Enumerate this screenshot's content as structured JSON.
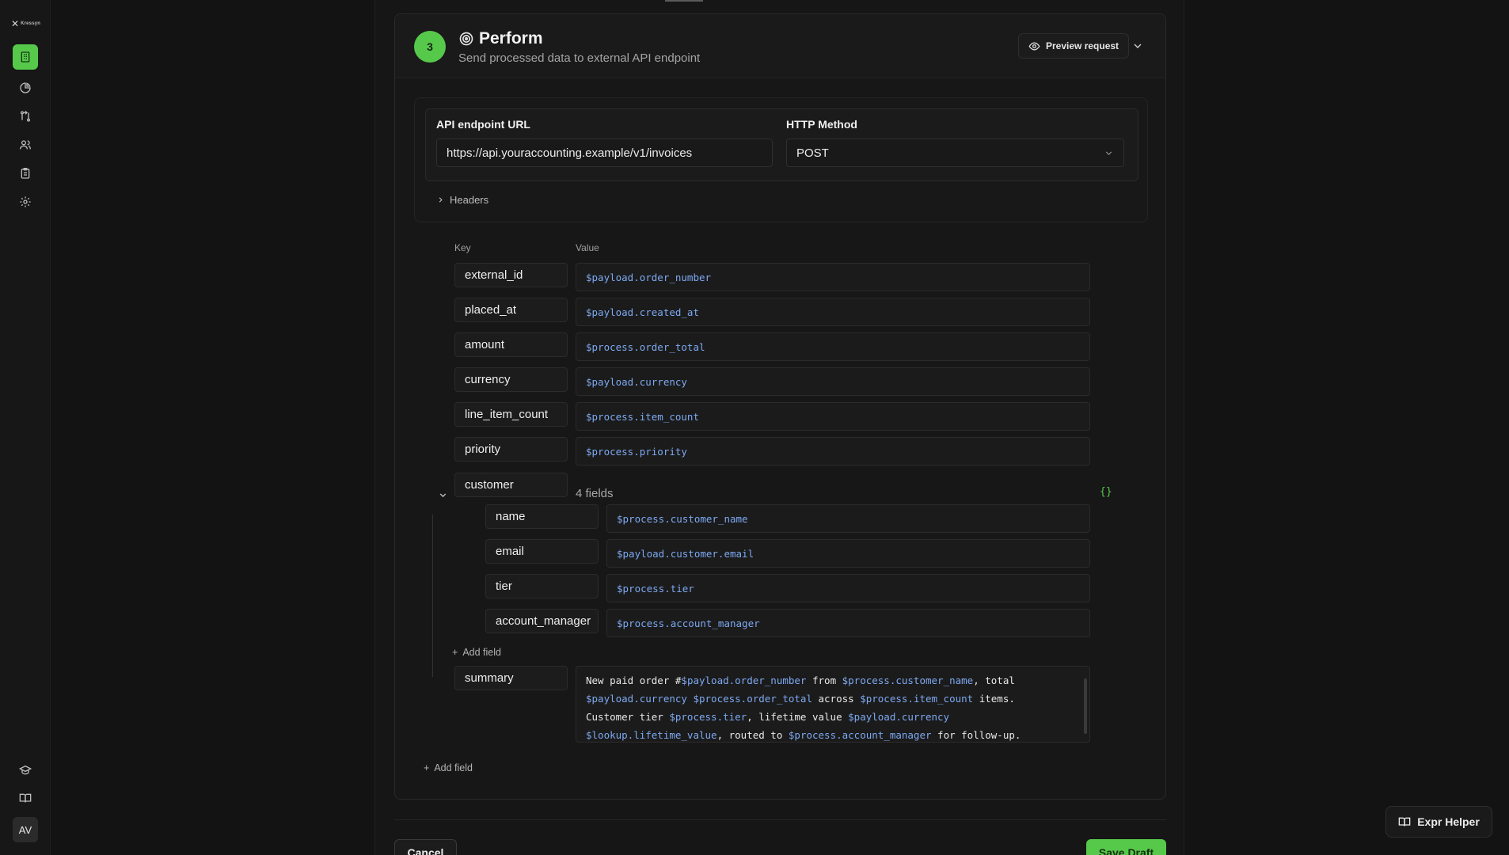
{
  "app": {
    "logo_text": "Kressyn",
    "avatar_initials": "AV"
  },
  "sidebar": {
    "items": [
      {
        "icon": "building-icon",
        "active": true
      },
      {
        "icon": "pie-chart-icon",
        "active": false
      },
      {
        "icon": "workflow-icon",
        "active": false
      },
      {
        "icon": "users-icon",
        "active": false
      },
      {
        "icon": "clipboard-icon",
        "active": false
      },
      {
        "icon": "gear-icon",
        "active": false
      }
    ],
    "bottom_items": [
      {
        "icon": "graduation-cap-icon"
      },
      {
        "icon": "book-icon"
      }
    ]
  },
  "step": {
    "number": "3",
    "title": "Perform",
    "subtitle": "Send processed data to external API endpoint",
    "preview_label": "Preview request"
  },
  "endpoint": {
    "url_label": "API endpoint URL",
    "url_value": "https://api.youraccounting.example/v1/invoices",
    "method_label": "HTTP Method",
    "method_value": "POST",
    "headers_label": "Headers"
  },
  "mapping": {
    "key_header": "Key",
    "value_header": "Value",
    "rows": [
      {
        "key": "external_id",
        "value": "$payload.order_number"
      },
      {
        "key": "placed_at",
        "value": "$payload.created_at"
      },
      {
        "key": "amount",
        "value": "$process.order_total"
      },
      {
        "key": "currency",
        "value": "$payload.currency"
      },
      {
        "key": "line_item_count",
        "value": "$process.item_count"
      },
      {
        "key": "priority",
        "value": "$process.priority"
      }
    ],
    "nested": {
      "key": "customer",
      "count_label": "4 fields",
      "json_icon_text": "{}",
      "rows": [
        {
          "key": "name",
          "value": "$process.customer_name"
        },
        {
          "key": "email",
          "value": "$payload.customer.email"
        },
        {
          "key": "tier",
          "value": "$process.tier"
        },
        {
          "key": "account_manager",
          "value": "$process.account_manager"
        }
      ],
      "add_label": "Add field"
    },
    "summary": {
      "key": "summary",
      "lines": [
        [
          {
            "t": "New paid order #"
          },
          {
            "t": "$payload.order_number",
            "v": true
          },
          {
            "t": " from "
          },
          {
            "t": "$process.customer_name",
            "v": true
          },
          {
            "t": ", total"
          }
        ],
        [
          {
            "t": "$payload.currency",
            "v": true
          },
          {
            "t": " "
          },
          {
            "t": "$process.order_total",
            "v": true
          },
          {
            "t": " across "
          },
          {
            "t": "$process.item_count",
            "v": true
          },
          {
            "t": " items."
          }
        ],
        [
          {
            "t": "Customer tier "
          },
          {
            "t": "$process.tier",
            "v": true
          },
          {
            "t": ", lifetime value "
          },
          {
            "t": "$payload.currency",
            "v": true
          }
        ],
        [
          {
            "t": "$lookup.lifetime_value",
            "v": true
          },
          {
            "t": ", routed to "
          },
          {
            "t": "$process.account_manager",
            "v": true
          },
          {
            "t": " for follow-up."
          }
        ]
      ]
    },
    "add_label": "Add field"
  },
  "footer": {
    "cancel_label": "Cancel",
    "save_label": "Save Draft"
  },
  "expr_helper": {
    "label": "Expr Helper"
  },
  "colors": {
    "accent": "#56c94b",
    "token": "#7da9f2",
    "background": "#131313"
  }
}
